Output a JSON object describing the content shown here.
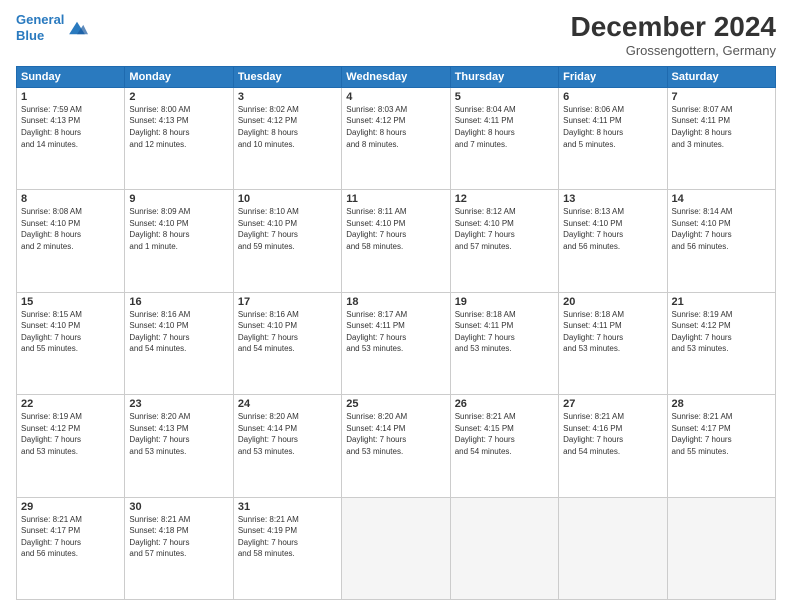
{
  "header": {
    "logo_line1": "General",
    "logo_line2": "Blue",
    "title": "December 2024",
    "subtitle": "Grossengottern, Germany"
  },
  "weekdays": [
    "Sunday",
    "Monday",
    "Tuesday",
    "Wednesday",
    "Thursday",
    "Friday",
    "Saturday"
  ],
  "weeks": [
    [
      {
        "day": "1",
        "lines": [
          "Sunrise: 7:59 AM",
          "Sunset: 4:13 PM",
          "Daylight: 8 hours",
          "and 14 minutes."
        ]
      },
      {
        "day": "2",
        "lines": [
          "Sunrise: 8:00 AM",
          "Sunset: 4:13 PM",
          "Daylight: 8 hours",
          "and 12 minutes."
        ]
      },
      {
        "day": "3",
        "lines": [
          "Sunrise: 8:02 AM",
          "Sunset: 4:12 PM",
          "Daylight: 8 hours",
          "and 10 minutes."
        ]
      },
      {
        "day": "4",
        "lines": [
          "Sunrise: 8:03 AM",
          "Sunset: 4:12 PM",
          "Daylight: 8 hours",
          "and 8 minutes."
        ]
      },
      {
        "day": "5",
        "lines": [
          "Sunrise: 8:04 AM",
          "Sunset: 4:11 PM",
          "Daylight: 8 hours",
          "and 7 minutes."
        ]
      },
      {
        "day": "6",
        "lines": [
          "Sunrise: 8:06 AM",
          "Sunset: 4:11 PM",
          "Daylight: 8 hours",
          "and 5 minutes."
        ]
      },
      {
        "day": "7",
        "lines": [
          "Sunrise: 8:07 AM",
          "Sunset: 4:11 PM",
          "Daylight: 8 hours",
          "and 3 minutes."
        ]
      }
    ],
    [
      {
        "day": "8",
        "lines": [
          "Sunrise: 8:08 AM",
          "Sunset: 4:10 PM",
          "Daylight: 8 hours",
          "and 2 minutes."
        ]
      },
      {
        "day": "9",
        "lines": [
          "Sunrise: 8:09 AM",
          "Sunset: 4:10 PM",
          "Daylight: 8 hours",
          "and 1 minute."
        ]
      },
      {
        "day": "10",
        "lines": [
          "Sunrise: 8:10 AM",
          "Sunset: 4:10 PM",
          "Daylight: 7 hours",
          "and 59 minutes."
        ]
      },
      {
        "day": "11",
        "lines": [
          "Sunrise: 8:11 AM",
          "Sunset: 4:10 PM",
          "Daylight: 7 hours",
          "and 58 minutes."
        ]
      },
      {
        "day": "12",
        "lines": [
          "Sunrise: 8:12 AM",
          "Sunset: 4:10 PM",
          "Daylight: 7 hours",
          "and 57 minutes."
        ]
      },
      {
        "day": "13",
        "lines": [
          "Sunrise: 8:13 AM",
          "Sunset: 4:10 PM",
          "Daylight: 7 hours",
          "and 56 minutes."
        ]
      },
      {
        "day": "14",
        "lines": [
          "Sunrise: 8:14 AM",
          "Sunset: 4:10 PM",
          "Daylight: 7 hours",
          "and 56 minutes."
        ]
      }
    ],
    [
      {
        "day": "15",
        "lines": [
          "Sunrise: 8:15 AM",
          "Sunset: 4:10 PM",
          "Daylight: 7 hours",
          "and 55 minutes."
        ]
      },
      {
        "day": "16",
        "lines": [
          "Sunrise: 8:16 AM",
          "Sunset: 4:10 PM",
          "Daylight: 7 hours",
          "and 54 minutes."
        ]
      },
      {
        "day": "17",
        "lines": [
          "Sunrise: 8:16 AM",
          "Sunset: 4:10 PM",
          "Daylight: 7 hours",
          "and 54 minutes."
        ]
      },
      {
        "day": "18",
        "lines": [
          "Sunrise: 8:17 AM",
          "Sunset: 4:11 PM",
          "Daylight: 7 hours",
          "and 53 minutes."
        ]
      },
      {
        "day": "19",
        "lines": [
          "Sunrise: 8:18 AM",
          "Sunset: 4:11 PM",
          "Daylight: 7 hours",
          "and 53 minutes."
        ]
      },
      {
        "day": "20",
        "lines": [
          "Sunrise: 8:18 AM",
          "Sunset: 4:11 PM",
          "Daylight: 7 hours",
          "and 53 minutes."
        ]
      },
      {
        "day": "21",
        "lines": [
          "Sunrise: 8:19 AM",
          "Sunset: 4:12 PM",
          "Daylight: 7 hours",
          "and 53 minutes."
        ]
      }
    ],
    [
      {
        "day": "22",
        "lines": [
          "Sunrise: 8:19 AM",
          "Sunset: 4:12 PM",
          "Daylight: 7 hours",
          "and 53 minutes."
        ]
      },
      {
        "day": "23",
        "lines": [
          "Sunrise: 8:20 AM",
          "Sunset: 4:13 PM",
          "Daylight: 7 hours",
          "and 53 minutes."
        ]
      },
      {
        "day": "24",
        "lines": [
          "Sunrise: 8:20 AM",
          "Sunset: 4:14 PM",
          "Daylight: 7 hours",
          "and 53 minutes."
        ]
      },
      {
        "day": "25",
        "lines": [
          "Sunrise: 8:20 AM",
          "Sunset: 4:14 PM",
          "Daylight: 7 hours",
          "and 53 minutes."
        ]
      },
      {
        "day": "26",
        "lines": [
          "Sunrise: 8:21 AM",
          "Sunset: 4:15 PM",
          "Daylight: 7 hours",
          "and 54 minutes."
        ]
      },
      {
        "day": "27",
        "lines": [
          "Sunrise: 8:21 AM",
          "Sunset: 4:16 PM",
          "Daylight: 7 hours",
          "and 54 minutes."
        ]
      },
      {
        "day": "28",
        "lines": [
          "Sunrise: 8:21 AM",
          "Sunset: 4:17 PM",
          "Daylight: 7 hours",
          "and 55 minutes."
        ]
      }
    ],
    [
      {
        "day": "29",
        "lines": [
          "Sunrise: 8:21 AM",
          "Sunset: 4:17 PM",
          "Daylight: 7 hours",
          "and 56 minutes."
        ]
      },
      {
        "day": "30",
        "lines": [
          "Sunrise: 8:21 AM",
          "Sunset: 4:18 PM",
          "Daylight: 7 hours",
          "and 57 minutes."
        ]
      },
      {
        "day": "31",
        "lines": [
          "Sunrise: 8:21 AM",
          "Sunset: 4:19 PM",
          "Daylight: 7 hours",
          "and 58 minutes."
        ]
      },
      null,
      null,
      null,
      null
    ]
  ]
}
